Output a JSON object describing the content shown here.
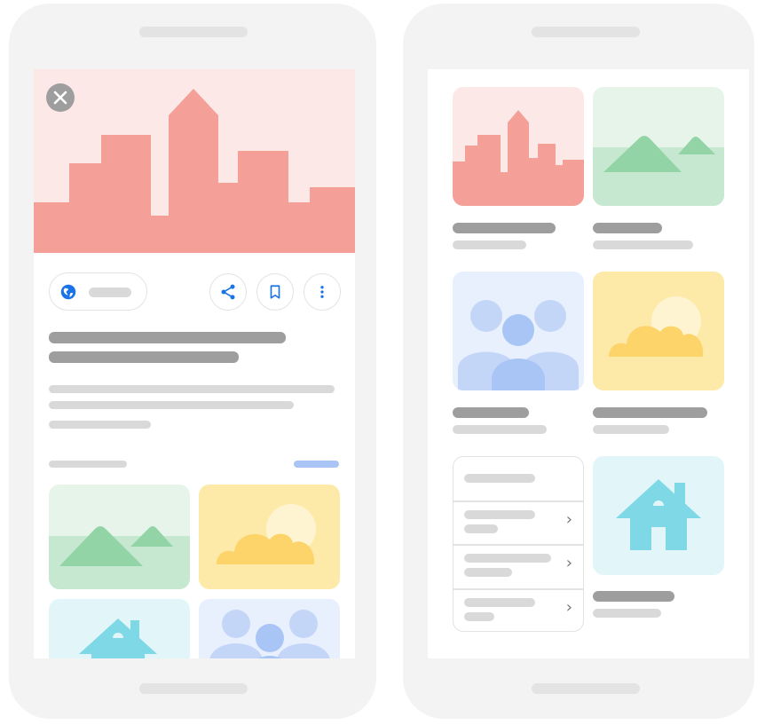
{
  "colors": {
    "phone_frame": "#f3f3f3",
    "skeleton_dark": "#9e9e9e",
    "skeleton_light": "#d9d9d9",
    "city_bg": "#fde8e8",
    "city_fill": "#f4a098",
    "landscape_bg": "#e6f4ea",
    "landscape_fill": "#93d4a6",
    "weather_bg": "#fde9a8",
    "weather_cloud": "#fcd46a",
    "people_bg": "#e8effd",
    "people_fill": "#a9c5f5",
    "house_bg": "#e2f6fa",
    "house_fill": "#7fd8e6",
    "accent_blue": "#1a73e8"
  },
  "left_phone": {
    "hero_image": "city-skyline-illustration",
    "close_icon": "close-icon",
    "website_chip_icon": "globe-icon",
    "action_icons": [
      "share-icon",
      "bookmark-icon",
      "more-vert-icon"
    ],
    "gallery_images": [
      "landscape-illustration",
      "weather-illustration",
      "house-illustration",
      "people-illustration"
    ]
  },
  "right_phone": {
    "grid_images": [
      "city-skyline-illustration",
      "landscape-illustration",
      "people-illustration",
      "weather-illustration",
      "house-illustration"
    ],
    "list_rows": 4,
    "chevron_icon": "chevron-right-icon",
    "chevron_glyph": "›"
  }
}
